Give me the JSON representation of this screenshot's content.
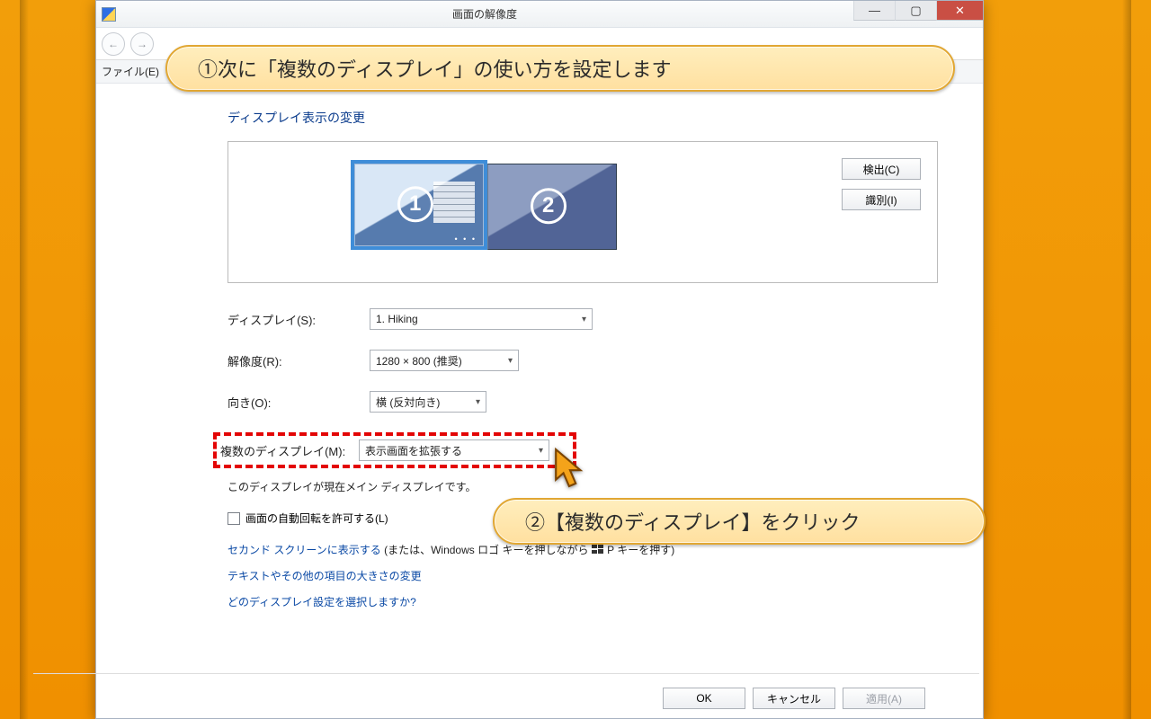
{
  "window": {
    "title": "画面の解像度"
  },
  "menubar": {
    "file": "ファイル(E)"
  },
  "heading": "ディスプレイ表示の変更",
  "sideButtons": {
    "detect": "検出(C)",
    "identify": "識別(I)"
  },
  "monitors": {
    "m1": "1",
    "m2": "2"
  },
  "labels": {
    "display": "ディスプレイ(S):",
    "resolution": "解像度(R):",
    "orientation": "向き(O):",
    "multi": "複数のディスプレイ(M):"
  },
  "values": {
    "display": "1. Hiking",
    "resolution": "1280 × 800 (推奨)",
    "orientation": "横 (反対向き)",
    "multi": "表示画面を拡張する"
  },
  "note": "このディスプレイが現在メイン ディスプレイです。",
  "checkbox": "画面の自動回転を許可する(L)",
  "links": {
    "project_link": "セカンド スクリーンに表示する",
    "project_rest": " (または、Windows ロゴ キーを押しながら  P キーを押す)",
    "textsize": "テキストやその他の項目の大きさの変更",
    "which": "どのディスプレイ設定を選択しますか?"
  },
  "footer": {
    "ok": "OK",
    "cancel": "キャンセル",
    "apply": "適用(A)"
  },
  "callouts": {
    "c1": "①次に「複数のディスプレイ」の使い方を設定します",
    "c2": "②【複数のディスプレイ】をクリック"
  }
}
